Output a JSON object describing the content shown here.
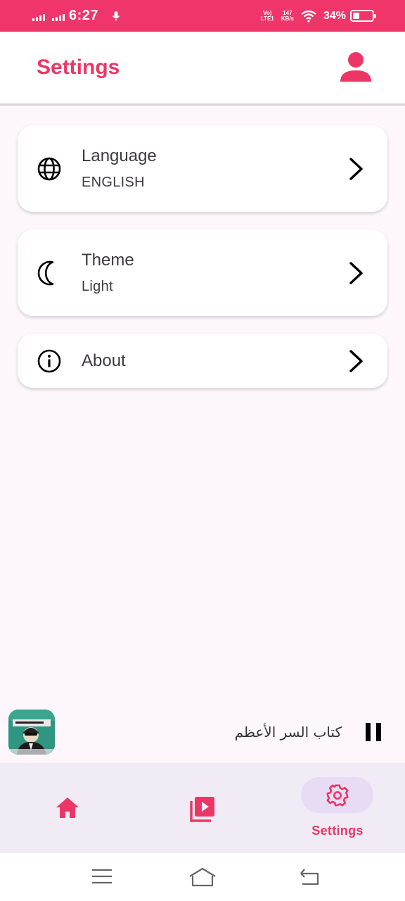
{
  "status_bar": {
    "time": "6:27",
    "network_top": "Vo)",
    "network_bottom": "LTE1",
    "speed_value": "147",
    "speed_unit": "KB/s",
    "battery_percent": "34%",
    "battery_level": 0.34
  },
  "header": {
    "title": "Settings",
    "profile_icon": "person-icon"
  },
  "settings": {
    "language": {
      "title": "Language",
      "value": "ENGLISH",
      "icon": "globe-icon"
    },
    "theme": {
      "title": "Theme",
      "value": "Light",
      "icon": "moon-icon"
    },
    "about": {
      "title": "About",
      "icon": "info-icon"
    }
  },
  "player": {
    "track_title": "كتاب السر الأعظم",
    "state_icon": "pause-icon"
  },
  "bottom_nav": {
    "items": [
      {
        "icon": "home-icon",
        "label": ""
      },
      {
        "icon": "video-library-icon",
        "label": ""
      },
      {
        "icon": "settings-icon",
        "label": "Settings",
        "active": true
      }
    ]
  },
  "colors": {
    "accent": "#ec3766",
    "status_bar": "#f0356a",
    "nav_background": "#f1ebf6",
    "active_pill": "#e8dcf5"
  }
}
